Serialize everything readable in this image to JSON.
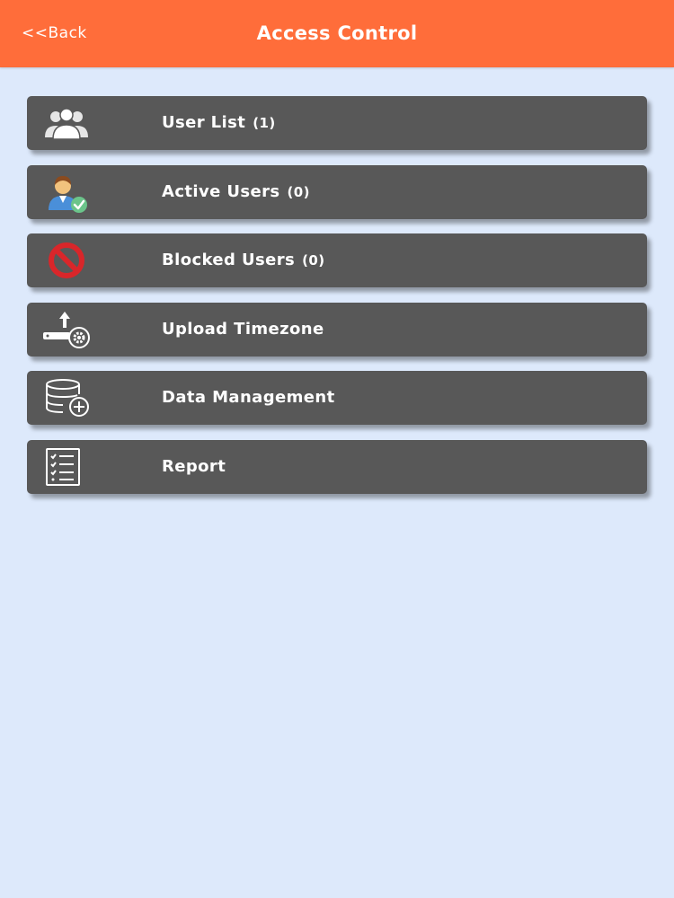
{
  "header": {
    "back_label": "<<Back",
    "title": "Access Control",
    "background": "#ff6d3a"
  },
  "menu": {
    "items": [
      {
        "label": "User List",
        "count": "(1)",
        "icon": "users-group-icon"
      },
      {
        "label": "Active Users",
        "count": "(0)",
        "icon": "active-user-icon"
      },
      {
        "label": "Blocked Users",
        "count": "(0)",
        "icon": "blocked-icon"
      },
      {
        "label": "Upload Timezone",
        "count": "",
        "icon": "upload-timezone-icon"
      },
      {
        "label": "Data Management",
        "count": "",
        "icon": "database-add-icon"
      },
      {
        "label": "Report",
        "count": "",
        "icon": "report-checklist-icon"
      }
    ],
    "item_background": "#585858",
    "page_background": "#dde9fb"
  }
}
